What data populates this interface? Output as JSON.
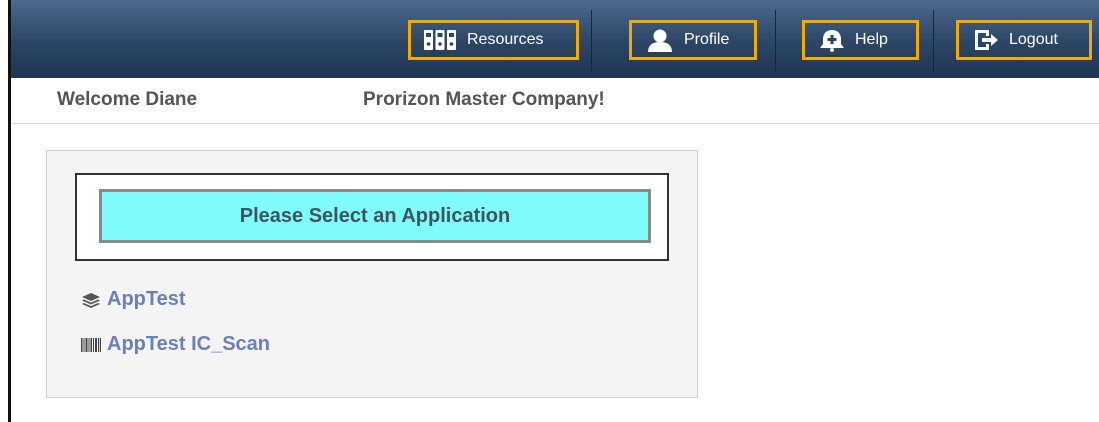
{
  "nav": {
    "resources_label": "Resources",
    "resources_icon": "binders-icon",
    "profile_label": "Profile",
    "profile_icon": "user-icon",
    "help_label": "Help",
    "help_icon": "help-bell-icon",
    "logout_label": "Logout",
    "logout_icon": "logout-icon",
    "highlight_color": "#f2a900",
    "bar_color": "#2c4566"
  },
  "welcome": {
    "user_text": "Welcome Diane",
    "company_text": "Prorizon Master Company!"
  },
  "apps": {
    "prompt": "Please Select an Application",
    "prompt_bg": "#7ffbfb",
    "items": [
      {
        "label": "AppTest",
        "icon": "layers-icon"
      },
      {
        "label": "AppTest IC_Scan",
        "icon": "barcode-icon"
      }
    ],
    "link_color": "#6a7fbd"
  }
}
